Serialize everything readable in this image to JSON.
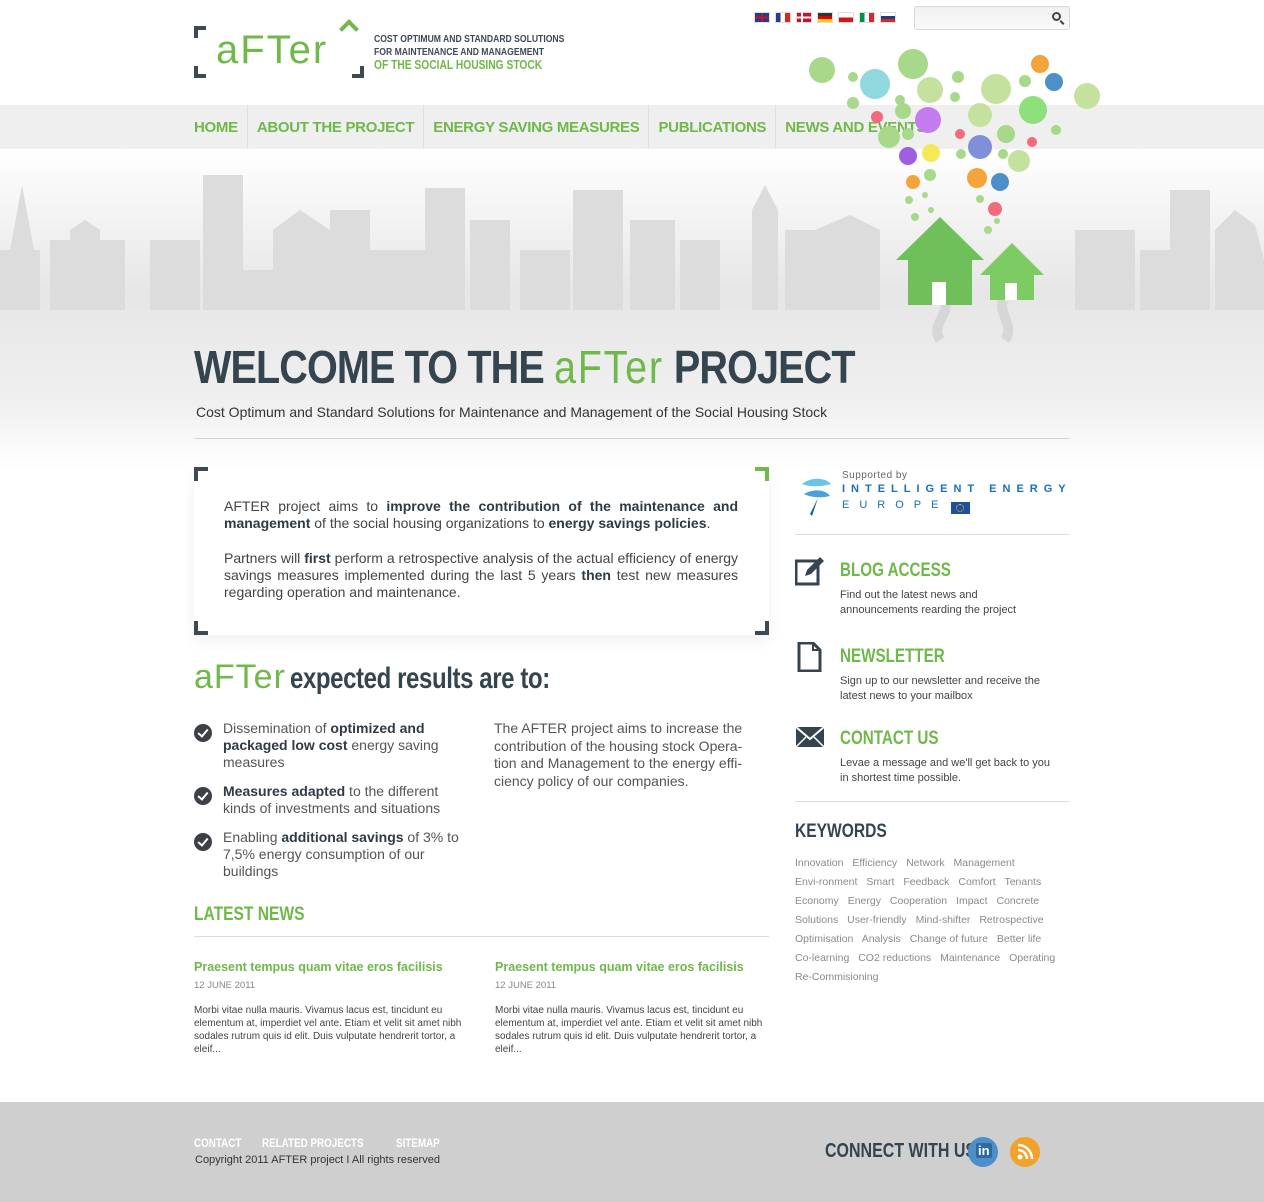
{
  "logo": {
    "word": "aFTer"
  },
  "tagline": {
    "line1": "COST OPTIMUM AND STANDARD SOLUTIONS",
    "line2": "FOR MAINTENANCE AND MANAGEMENT",
    "line3": "OF THE SOCIAL HOUSING STOCK"
  },
  "flags": [
    "uk-flag",
    "fr-flag",
    "dk-flag",
    "de-flag",
    "cz-flag",
    "it-flag",
    "si-flag"
  ],
  "search": {
    "placeholder": ""
  },
  "nav": [
    "HOME",
    "ABOUT THE PROJECT",
    "ENERGY SAVING MEASURES",
    "PUBLICATIONS",
    "NEWS AND EVENTS"
  ],
  "hero": {
    "welcome_pre": "WELCOME TO THE",
    "welcome_logo": "aFTer",
    "welcome_post": "PROJECT",
    "subtitle": "Cost Optimum and Standard Solutions for Maintenance and Management of the Social Housing Stock"
  },
  "intro": {
    "p1_a": "AFTER project aims to ",
    "p1_b": "improve the contribution of the maintenance and management",
    "p1_c": " of the social housing organizations to ",
    "p1_d": "energy savings policies",
    "p1_e": ".",
    "p2_a": "Partners will ",
    "p2_b": "first",
    "p2_c": " perform a retrospective analysis of the actual efficiency of energy savings measures implemented during the last 5 years ",
    "p2_d": "then",
    "p2_e": " test new measures regarding operation and maintenance."
  },
  "results": {
    "title_logo": "aFTer",
    "title_rest": "expected results are to:",
    "items": [
      {
        "a": "Dissemination of ",
        "b": "optimized and packaged low cost",
        "c": " energy saving measures"
      },
      {
        "a": "",
        "b": "Measures adapted",
        "c": " to the different kinds of investments and situations"
      },
      {
        "a": "Enabling ",
        "b": "additional savings",
        "c": " of 3% to 7,5% energy consumption of our buildings"
      }
    ],
    "paragraph": "The AFTER project aims to increase the contribution of the housing stock Opera-tion and Management to the energy effi-ciency policy of our companies."
  },
  "news": {
    "title": "LATEST NEWS",
    "items": [
      {
        "headline": "Praesent tempus quam vitae eros facilisis",
        "date": "12 JUNE 2011",
        "body": "Morbi vitae nulla mauris. Vivamus lacus est, tincidunt eu elementum at, imperdiet vel ante. Etiam et velit sit amet nibh sodales rutrum quis id elit. Duis vulputate hendrerit tortor, a eleif..."
      },
      {
        "headline": "Praesent tempus quam vitae eros facilisis",
        "date": "12 JUNE 2011",
        "body": "Morbi vitae nulla mauris. Vivamus lacus est, tincidunt eu elementum at, imperdiet vel ante. Etiam et velit sit amet nibh sodales rutrum quis id elit. Duis vulputate hendrerit tortor, a eleif..."
      }
    ]
  },
  "sidebar": {
    "supported_by": "Supported by",
    "ie_line1": "INTELLIGENT ENERGY",
    "ie_line2": "EUROPE",
    "blocks": [
      {
        "icon": "edit-icon",
        "title": "BLOG ACCESS",
        "text": "Find out the latest news and announcements rearding the project"
      },
      {
        "icon": "document-icon",
        "title": "NEWSLETTER",
        "text": "Sign up to our newsletter and receive the latest news to your mailbox"
      },
      {
        "icon": "envelope-icon",
        "title": "CONTACT US",
        "text": "Levae a message and we'll get back to you in shortest time possible."
      }
    ],
    "keywords_title": "KEYWORDS",
    "keywords": [
      "Innovation",
      "Efficiency",
      "Network",
      "Management",
      "Envi-ronment",
      "Smart",
      "Feedback",
      "Comfort",
      "Tenants",
      "Economy",
      "Energy",
      "Cooperation",
      "Impact",
      "Concrete",
      "Solutions",
      "User-friendly",
      "Mind-shifter",
      "Retrospective",
      "Optimisation",
      "Analysis",
      "Change of future",
      "Better life",
      "Co-learning",
      "CO2 reductions",
      "Maintenance",
      "Operating",
      "Re-Commisioning"
    ]
  },
  "footer": {
    "links": [
      "CONTACT",
      "RELATED PROJECTS",
      "SITEMAP"
    ],
    "copyright": "Copyright 2011 AFTER project I All rights reserved",
    "connect": "CONNECT WITH US"
  },
  "colors": {
    "accent": "#6fb84a",
    "dark": "#344550",
    "footer_bg": "#cfcfcf"
  }
}
